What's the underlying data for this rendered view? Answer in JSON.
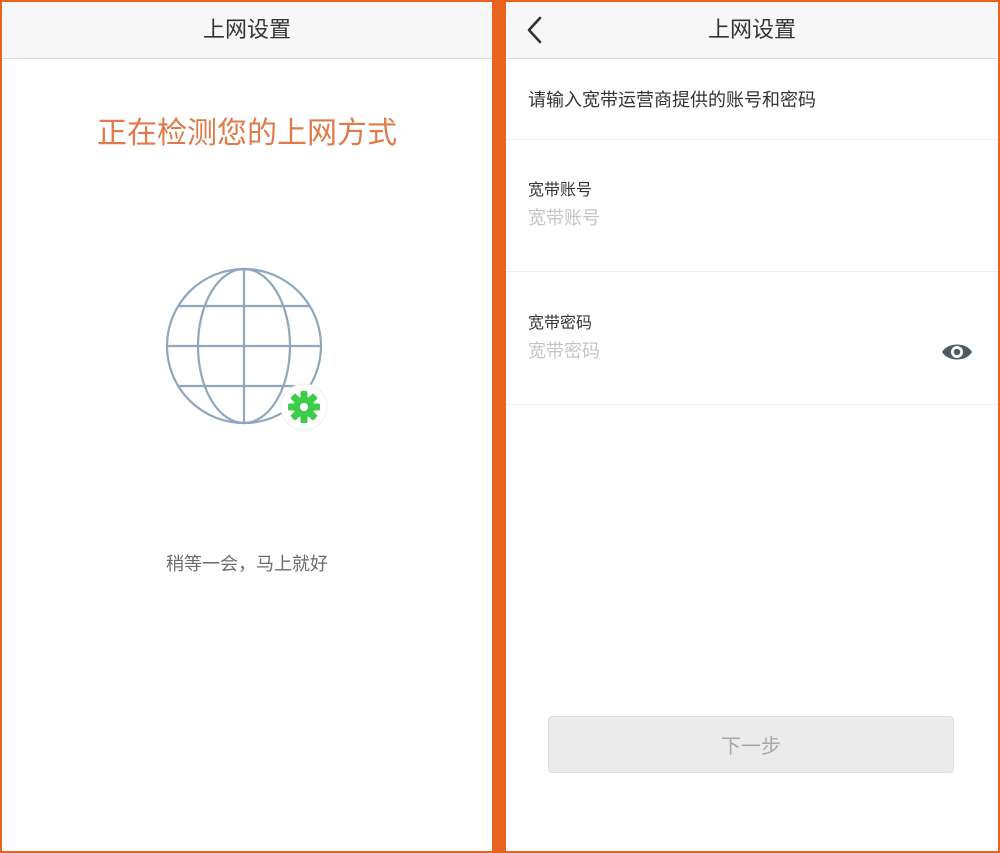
{
  "left_screen": {
    "nav_title": "上网设置",
    "detect_title": "正在检测您的上网方式",
    "globe_icon": "globe-icon",
    "gear_icon": "gear-icon",
    "wait_text": "稍等一会，马上就好"
  },
  "right_screen": {
    "nav_title": "上网设置",
    "back_icon": "chevron-left-icon",
    "hint": "请输入宽带运营商提供的账号和密码",
    "account": {
      "label": "宽带账号",
      "placeholder": "宽带账号",
      "value": ""
    },
    "password": {
      "label": "宽带密码",
      "placeholder": "宽带密码",
      "value": "",
      "toggle_icon": "eye-icon"
    },
    "next_label": "下一步"
  },
  "colors": {
    "frame": "#e8641e",
    "accent_text": "#e07a4a",
    "globe_stroke": "#8fa6bd",
    "gear": "#3dcc4a"
  }
}
